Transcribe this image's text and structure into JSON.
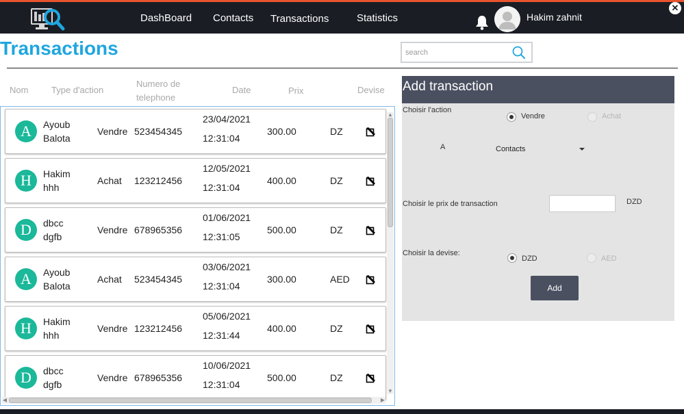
{
  "nav": {
    "items": [
      "DashBoard",
      "Contacts",
      "Transactions",
      "Statistics"
    ],
    "user_name": "Hakim zahnit",
    "close_label": "✕"
  },
  "page": {
    "title": "Transactions",
    "search_placeholder": "search"
  },
  "table": {
    "headers": {
      "nom": "Nom",
      "type_action": "Type d'action",
      "phone_line1": "Numero de",
      "phone_line2": "telephone",
      "date": "Date",
      "prix": "Prix",
      "devise": "Devise"
    },
    "rows": [
      {
        "initial": "A",
        "first": "Ayoub",
        "last": "Balota",
        "action": "Vendre",
        "phone": "523454345",
        "date": "23/04/2021",
        "time": "12:31:04",
        "price": "300.00",
        "devise": "DZ"
      },
      {
        "initial": "H",
        "first": "Hakim",
        "last": "hhh",
        "action": "Achat",
        "phone": "123212456",
        "date": "12/05/2021",
        "time": "12:31:04",
        "price": "400.00",
        "devise": "DZ"
      },
      {
        "initial": "D",
        "first": "dbcc",
        "last": "dgfb",
        "action": "Vendre",
        "phone": "678965356",
        "date": "01/06/2021",
        "time": "12:31:05",
        "price": "500.00",
        "devise": "DZ"
      },
      {
        "initial": "A",
        "first": "Ayoub",
        "last": "Balota",
        "action": "Achat",
        "phone": "523454345",
        "date": "03/06/2021",
        "time": "12:31:04",
        "price": "300.00",
        "devise": "AED"
      },
      {
        "initial": "H",
        "first": "Hakim",
        "last": "hhh",
        "action": "Vendre",
        "phone": "123212456",
        "date": "05/06/2021",
        "time": "12:31:44",
        "price": "400.00",
        "devise": "DZ"
      },
      {
        "initial": "D",
        "first": "dbcc",
        "last": "dgfb",
        "action": "Vendre",
        "phone": "678965356",
        "date": "10/06/2021",
        "time": "12:31:04",
        "price": "500.00",
        "devise": "DZ"
      }
    ]
  },
  "form": {
    "title": "Add transaction",
    "action_label": "Choisir  l'action",
    "vendre": "Vendre",
    "achat": "Achat",
    "selected_action": "Vendre",
    "a_label": "A",
    "contact_select": "Contacts",
    "price_label": "Choisir le prix de transaction",
    "price_value": "",
    "price_currency": "DZD",
    "devise_label": "Choisir la devise:",
    "dzd": "DZD",
    "aed": "AED",
    "selected_devise": "DZD",
    "add_button": "Add"
  },
  "icons": {
    "logo": "monitor-search-logo-icon",
    "bell": "bell-icon",
    "avatar": "user-avatar-icon",
    "search": "search-icon",
    "edit": "edit-icon",
    "close": "close-icon"
  },
  "colors": {
    "topbar": "#1a1d24",
    "topbar_accent": "#e8542e",
    "title": "#1fa6df",
    "avatar_bg": "#1bb89a",
    "panel_header": "#4a5060",
    "panel_bg": "#e4e4e4",
    "add_button": "#4a5060"
  }
}
